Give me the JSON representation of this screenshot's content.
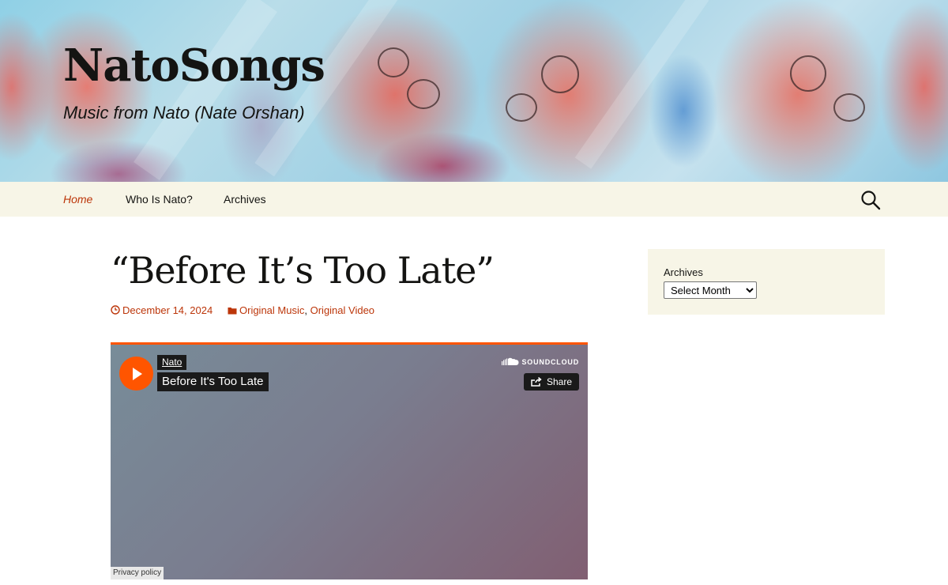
{
  "site": {
    "title": "NatoSongs",
    "description": "Music from Nato (Nate Orshan)"
  },
  "nav": {
    "items": [
      {
        "label": "Home",
        "active": true
      },
      {
        "label": "Who Is Nato?",
        "active": false
      },
      {
        "label": "Archives",
        "active": false
      }
    ],
    "search_icon": "search-icon"
  },
  "post": {
    "title": "“Before It’s Too Late”",
    "date": "December 14, 2024",
    "categories": [
      "Original Music",
      "Original Video"
    ],
    "category_separator": ","
  },
  "embed": {
    "artist": "Nato",
    "track": "Before It's Too Late",
    "provider": "SOUNDCLOUD",
    "share_label": "Share",
    "privacy_label": "Privacy policy"
  },
  "sidebar": {
    "widget_title": "Archives",
    "select_value": "Select Month"
  },
  "colors": {
    "accent": "#bc360a",
    "navbar_bg": "#f7f5e7",
    "soundcloud_orange": "#ff5500"
  }
}
